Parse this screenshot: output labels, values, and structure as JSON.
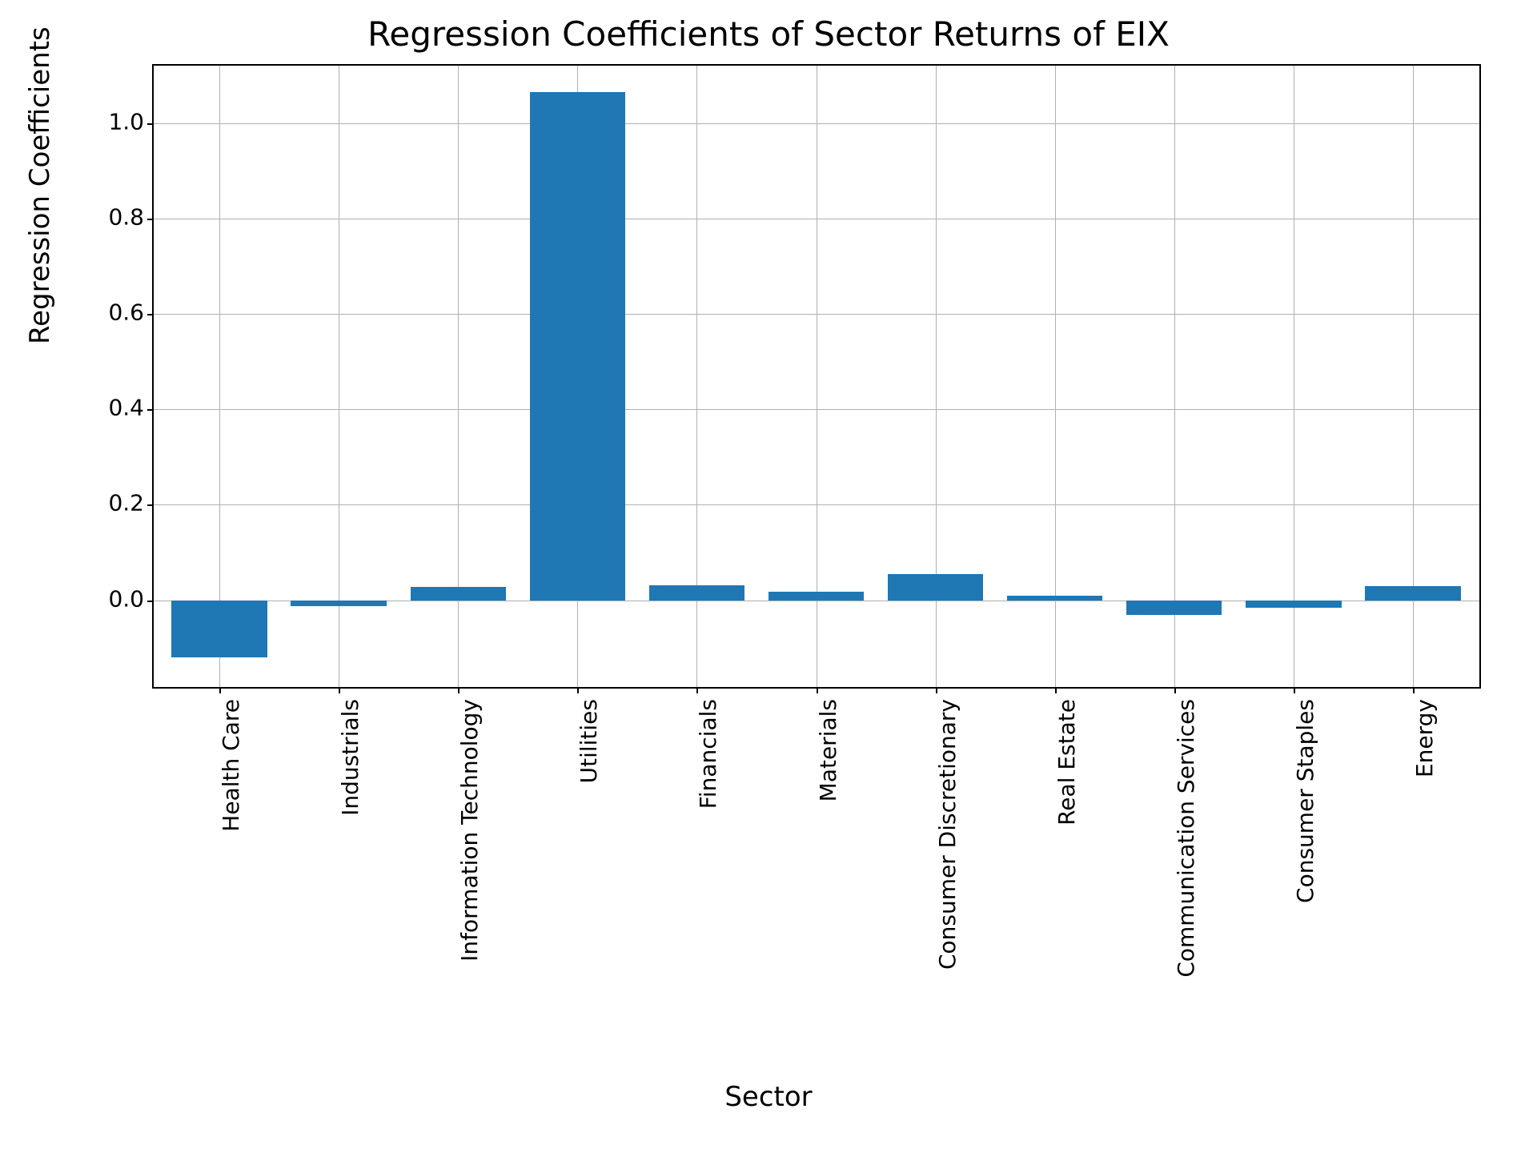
{
  "chart_data": {
    "type": "bar",
    "title": "Regression Coefficients of Sector Returns of EIX",
    "xlabel": "Sector",
    "ylabel": "Regression Coefficients",
    "categories": [
      "Health Care",
      "Industrials",
      "Information Technology",
      "Utilities",
      "Financials",
      "Materials",
      "Consumer Discretionary",
      "Real Estate",
      "Communication Services",
      "Consumer Staples",
      "Energy"
    ],
    "values": [
      -0.12,
      -0.012,
      0.028,
      1.065,
      0.032,
      0.018,
      0.055,
      0.01,
      -0.03,
      -0.015,
      0.03
    ],
    "ylim": [
      -0.18,
      1.12
    ],
    "yticks": [
      0.0,
      0.2,
      0.4,
      0.6,
      0.8,
      1.0
    ],
    "ytick_labels": [
      "0.0",
      "0.2",
      "0.4",
      "0.6",
      "0.8",
      "1.0"
    ],
    "bar_color": "#1f77b4",
    "grid": true
  }
}
